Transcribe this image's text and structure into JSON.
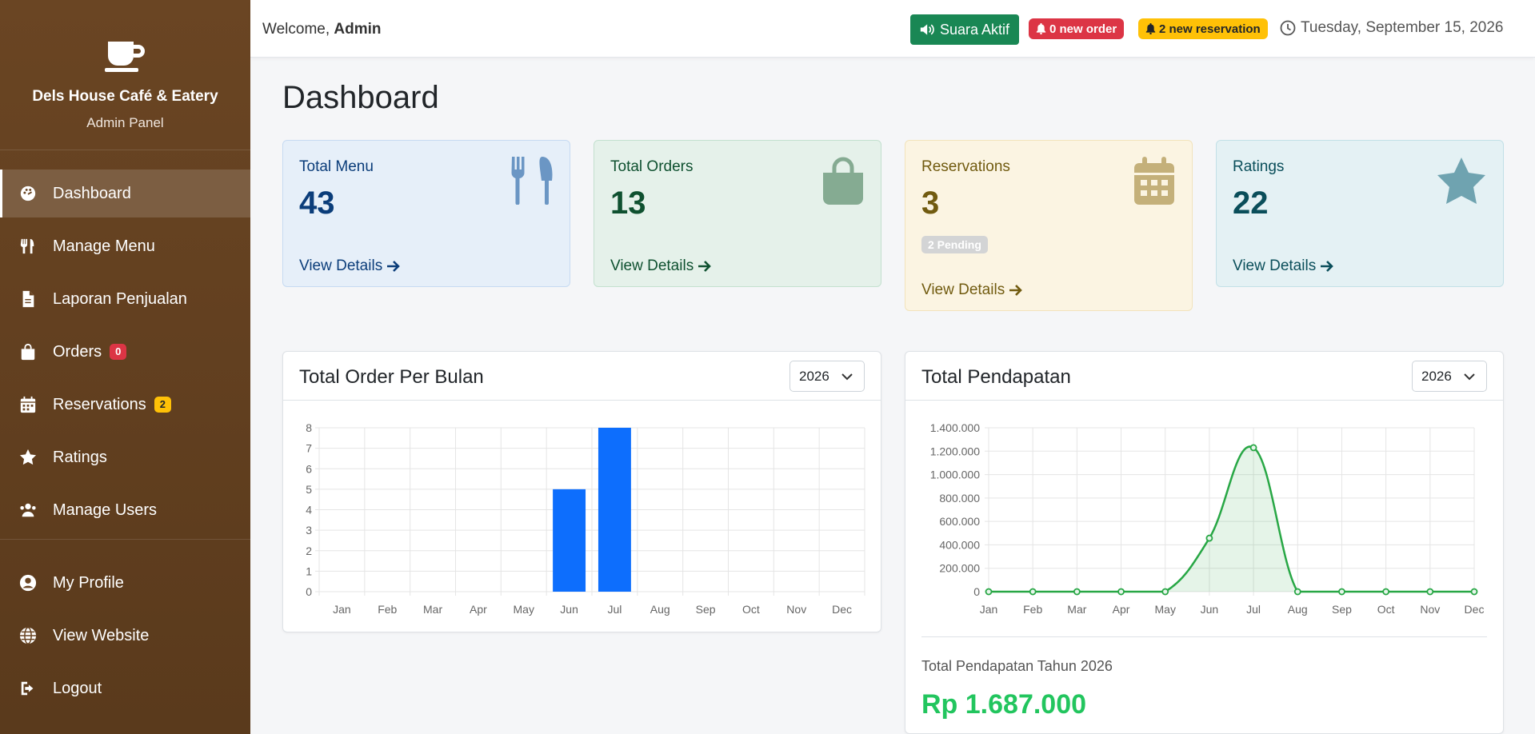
{
  "sidebar": {
    "brand_title": "Dels House Café & Eatery",
    "brand_sub": "Admin Panel",
    "items": [
      {
        "label": "Dashboard",
        "icon": "palette-icon",
        "active": true
      },
      {
        "label": "Manage Menu",
        "icon": "utensils-icon"
      },
      {
        "label": "Laporan Penjualan",
        "icon": "file-icon"
      },
      {
        "label": "Orders",
        "icon": "bag-icon",
        "badge": "0"
      },
      {
        "label": "Reservations",
        "icon": "calendar-icon",
        "badge": "2"
      },
      {
        "label": "Ratings",
        "icon": "star-icon"
      },
      {
        "label": "Manage Users",
        "icon": "users-icon"
      }
    ],
    "bottom_items": [
      {
        "label": "My Profile",
        "icon": "user-icon"
      },
      {
        "label": "View Website",
        "icon": "globe-icon"
      },
      {
        "label": "Logout",
        "icon": "logout-icon"
      }
    ]
  },
  "topbar": {
    "welcome_prefix": "Welcome,",
    "welcome_user": "Admin",
    "sound_label": "Suara Aktif",
    "order_badge": "0 new order",
    "reservation_badge": "2 new reservation",
    "date": "Tuesday, September 15, 2026"
  },
  "main": {
    "title": "Dashboard",
    "cards": {
      "menu": {
        "label": "Total Menu",
        "value": "43",
        "link": "View Details"
      },
      "orders": {
        "label": "Total Orders",
        "value": "13",
        "link": "View Details"
      },
      "reservations": {
        "label": "Reservations",
        "value": "3",
        "pending": "2 Pending",
        "link": "View Details"
      },
      "ratings": {
        "label": "Ratings",
        "value": "22",
        "link": "View Details"
      }
    },
    "order_panel": {
      "title": "Total Order Per Bulan",
      "year": "2026"
    },
    "revenue_panel": {
      "title": "Total Pendapatan",
      "year": "2026",
      "total_label": "Total Pendapatan Tahun 2026",
      "total_value": "Rp 1.687.000"
    }
  },
  "colors": {
    "sidebar": "#5a3a1c",
    "bar": "#0d6efd",
    "line": "#28a745",
    "revenue_value": "#22c55e"
  },
  "chart_data": [
    {
      "type": "bar",
      "title": "",
      "categories": [
        "Jan",
        "Feb",
        "Mar",
        "Apr",
        "May",
        "Jun",
        "Jul",
        "Aug",
        "Sep",
        "Oct",
        "Nov",
        "Dec"
      ],
      "values": [
        0,
        0,
        0,
        0,
        0,
        5,
        8,
        0,
        0,
        0,
        0,
        0
      ],
      "ylim": [
        0,
        8
      ],
      "yticks": [
        "0",
        "1",
        "2",
        "3",
        "4",
        "5",
        "6",
        "7",
        "8"
      ],
      "grid": true
    },
    {
      "type": "area",
      "title": "",
      "categories": [
        "Jan",
        "Feb",
        "Mar",
        "Apr",
        "May",
        "Jun",
        "Jul",
        "Aug",
        "Sep",
        "Oct",
        "Nov",
        "Dec"
      ],
      "values": [
        0,
        0,
        0,
        0,
        0,
        457000,
        1230000,
        0,
        0,
        0,
        0,
        0
      ],
      "ylim": [
        0,
        1400000
      ],
      "yticks": [
        "0",
        "200.000",
        "400.000",
        "600.000",
        "800.000",
        "1.000.000",
        "1.200.000",
        "1.400.000"
      ],
      "grid": true
    }
  ]
}
